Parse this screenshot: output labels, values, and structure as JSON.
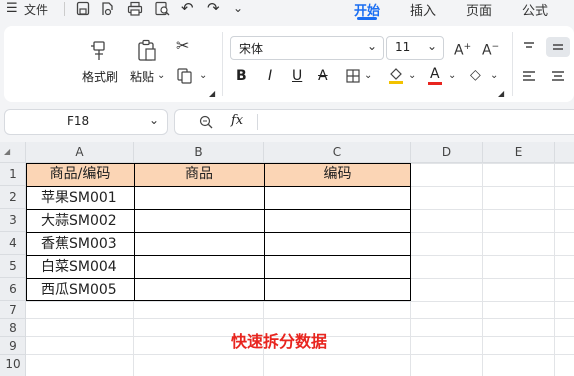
{
  "menu": {
    "file_label": "文件"
  },
  "tabs": [
    {
      "label": "开始",
      "active": true
    },
    {
      "label": "插入",
      "active": false
    },
    {
      "label": "页面",
      "active": false
    },
    {
      "label": "公式",
      "active": false
    }
  ],
  "ribbon": {
    "format_painter": "格式刷",
    "paste": "粘贴",
    "font_name": "宋体",
    "font_size": "11",
    "bold": "B",
    "italic": "I",
    "underline": "U",
    "strike": "A",
    "font_color": "A"
  },
  "formula_bar": {
    "name_box": "F18",
    "fx": "fx",
    "value": ""
  },
  "sheet": {
    "columns": [
      "A",
      "B",
      "C",
      "D",
      "E"
    ],
    "rows": [
      "1",
      "2",
      "3",
      "4",
      "5",
      "6",
      "7",
      "8",
      "9",
      "10"
    ],
    "header_row": [
      "商品/编码",
      "商品",
      "编码"
    ],
    "data": [
      "苹果SM001",
      "大蒜SM002",
      "香蕉SM003",
      "白菜SM004",
      "西瓜SM005"
    ],
    "caption": "快速拆分数据"
  },
  "colors": {
    "accent": "#1a6ef2",
    "header_fill": "#fbd5b5",
    "caption": "#e8251f"
  }
}
